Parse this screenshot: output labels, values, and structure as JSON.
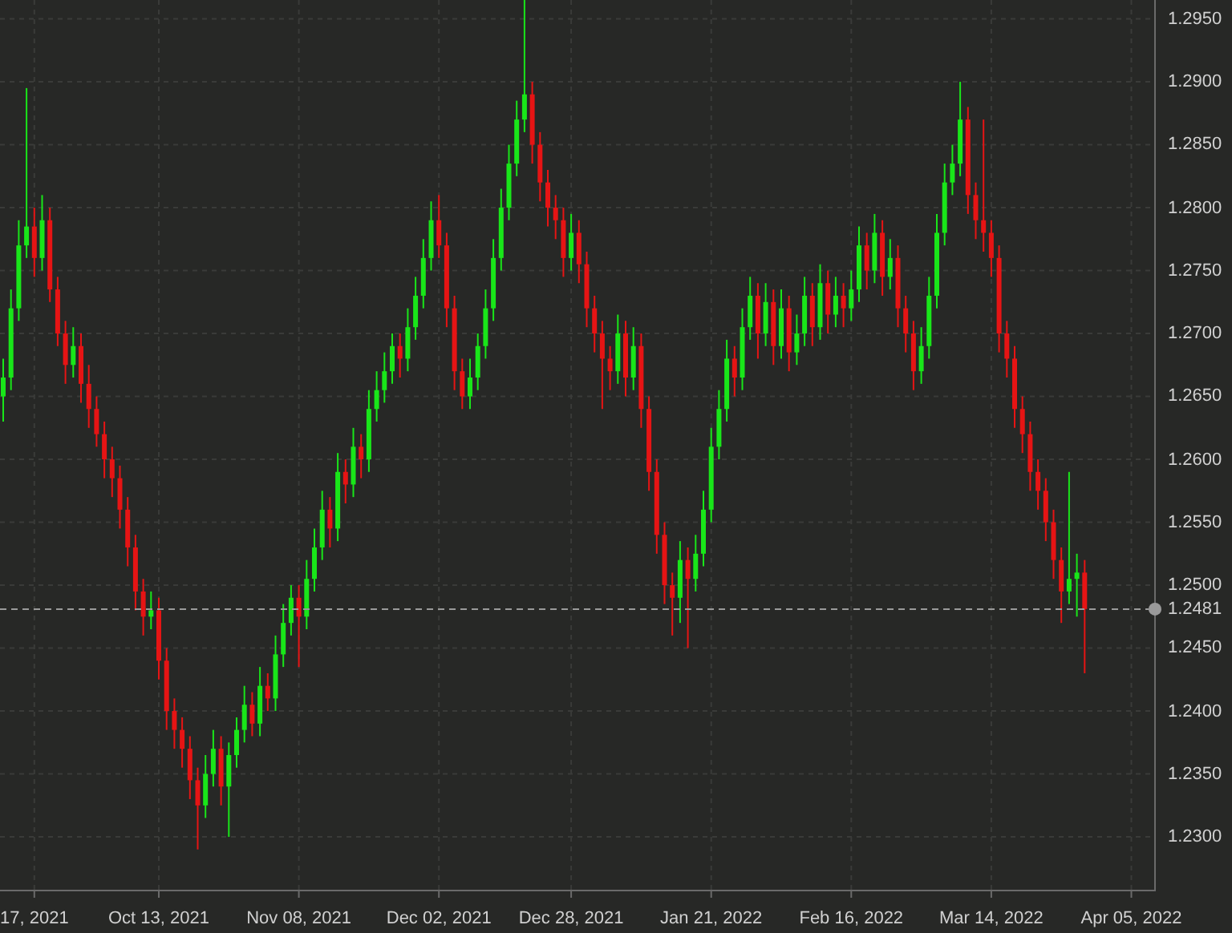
{
  "chart": {
    "chart_data": {
      "type": "candlestick",
      "categories": [
        null,
        null,
        null,
        null,
        "17, 2021",
        null,
        null,
        null,
        null,
        null,
        null,
        null,
        null,
        null,
        null,
        null,
        null,
        null,
        null,
        null,
        "Oct 13, 2021",
        null,
        null,
        null,
        null,
        null,
        null,
        null,
        null,
        null,
        null,
        null,
        null,
        null,
        null,
        null,
        null,
        null,
        "Nov 08, 2021",
        null,
        null,
        null,
        null,
        null,
        null,
        null,
        null,
        null,
        null,
        null,
        null,
        null,
        null,
        null,
        null,
        null,
        "Dec 02, 2021",
        null,
        null,
        null,
        null,
        null,
        null,
        null,
        null,
        null,
        null,
        null,
        null,
        null,
        null,
        null,
        null,
        "Dec 28, 2021",
        null,
        null,
        null,
        null,
        null,
        null,
        null,
        null,
        null,
        null,
        null,
        null,
        null,
        null,
        null,
        null,
        null,
        "Jan 21, 2022",
        null,
        null,
        null,
        null,
        null,
        null,
        null,
        null,
        null,
        null,
        null,
        null,
        null,
        null,
        null,
        null,
        null,
        "Feb 16, 2022",
        null,
        null,
        null,
        null,
        null,
        null,
        null,
        null,
        null,
        null,
        null,
        null,
        null,
        null,
        null,
        null,
        null,
        "Mar 14, 2022",
        null,
        null,
        null,
        null,
        null,
        null,
        null,
        null,
        null,
        null,
        null,
        null,
        null,
        null,
        null,
        null,
        null,
        "Apr 05, 2022"
      ],
      "ohlc": [
        [
          1.265,
          1.268,
          1.263,
          1.2665
        ],
        [
          1.2665,
          1.2735,
          1.2655,
          1.272
        ],
        [
          1.272,
          1.279,
          1.271,
          1.277
        ],
        [
          1.277,
          1.2895,
          1.276,
          1.2785
        ],
        [
          1.2785,
          1.28,
          1.2745,
          1.276
        ],
        [
          1.276,
          1.281,
          1.275,
          1.279
        ],
        [
          1.279,
          1.28,
          1.2725,
          1.2735
        ],
        [
          1.2735,
          1.2745,
          1.269,
          1.27
        ],
        [
          1.27,
          1.271,
          1.266,
          1.2675
        ],
        [
          1.2675,
          1.2705,
          1.2665,
          1.269
        ],
        [
          1.269,
          1.27,
          1.2645,
          1.266
        ],
        [
          1.266,
          1.2675,
          1.2625,
          1.264
        ],
        [
          1.264,
          1.265,
          1.261,
          1.262
        ],
        [
          1.262,
          1.263,
          1.2585,
          1.26
        ],
        [
          1.26,
          1.261,
          1.257,
          1.2585
        ],
        [
          1.2585,
          1.2595,
          1.2545,
          1.256
        ],
        [
          1.256,
          1.257,
          1.2515,
          1.253
        ],
        [
          1.253,
          1.254,
          1.248,
          1.2495
        ],
        [
          1.2495,
          1.2505,
          1.246,
          1.2475
        ],
        [
          1.2475,
          1.2495,
          1.2465,
          1.248
        ],
        [
          1.248,
          1.249,
          1.2425,
          1.244
        ],
        [
          1.244,
          1.245,
          1.2385,
          1.24
        ],
        [
          1.24,
          1.241,
          1.237,
          1.2385
        ],
        [
          1.2385,
          1.2395,
          1.2355,
          1.237
        ],
        [
          1.237,
          1.238,
          1.233,
          1.2345
        ],
        [
          1.2345,
          1.2355,
          1.229,
          1.2325
        ],
        [
          1.2325,
          1.2365,
          1.2315,
          1.235
        ],
        [
          1.235,
          1.2385,
          1.234,
          1.237
        ],
        [
          1.237,
          1.238,
          1.2325,
          1.234
        ],
        [
          1.234,
          1.2375,
          1.23,
          1.2365
        ],
        [
          1.2365,
          1.2395,
          1.2355,
          1.2385
        ],
        [
          1.2385,
          1.242,
          1.2375,
          1.2405
        ],
        [
          1.2405,
          1.2415,
          1.238,
          1.239
        ],
        [
          1.239,
          1.2435,
          1.238,
          1.242
        ],
        [
          1.242,
          1.243,
          1.24,
          1.241
        ],
        [
          1.241,
          1.246,
          1.24,
          1.2445
        ],
        [
          1.2445,
          1.2485,
          1.2435,
          1.247
        ],
        [
          1.247,
          1.25,
          1.246,
          1.249
        ],
        [
          1.249,
          1.25,
          1.2435,
          1.2475
        ],
        [
          1.2475,
          1.252,
          1.2465,
          1.2505
        ],
        [
          1.2505,
          1.2545,
          1.2495,
          1.253
        ],
        [
          1.253,
          1.2575,
          1.252,
          1.256
        ],
        [
          1.256,
          1.257,
          1.253,
          1.2545
        ],
        [
          1.2545,
          1.2605,
          1.2535,
          1.259
        ],
        [
          1.259,
          1.26,
          1.2565,
          1.258
        ],
        [
          1.258,
          1.2625,
          1.257,
          1.261
        ],
        [
          1.261,
          1.262,
          1.2585,
          1.26
        ],
        [
          1.26,
          1.2655,
          1.259,
          1.264
        ],
        [
          1.264,
          1.267,
          1.263,
          1.2655
        ],
        [
          1.2655,
          1.2685,
          1.2645,
          1.267
        ],
        [
          1.267,
          1.27,
          1.266,
          1.269
        ],
        [
          1.269,
          1.27,
          1.2665,
          1.268
        ],
        [
          1.268,
          1.272,
          1.267,
          1.2705
        ],
        [
          1.2705,
          1.2745,
          1.2695,
          1.273
        ],
        [
          1.273,
          1.2775,
          1.272,
          1.276
        ],
        [
          1.276,
          1.2805,
          1.275,
          1.279
        ],
        [
          1.279,
          1.281,
          1.276,
          1.277
        ],
        [
          1.277,
          1.278,
          1.2705,
          1.272
        ],
        [
          1.272,
          1.273,
          1.2655,
          1.267
        ],
        [
          1.267,
          1.268,
          1.264,
          1.265
        ],
        [
          1.265,
          1.268,
          1.264,
          1.2665
        ],
        [
          1.2665,
          1.27,
          1.2655,
          1.269
        ],
        [
          1.269,
          1.2735,
          1.268,
          1.272
        ],
        [
          1.272,
          1.2775,
          1.271,
          1.276
        ],
        [
          1.276,
          1.2815,
          1.275,
          1.28
        ],
        [
          1.28,
          1.285,
          1.279,
          1.2835
        ],
        [
          1.2835,
          1.2885,
          1.2825,
          1.287
        ],
        [
          1.287,
          1.2965,
          1.286,
          1.289
        ],
        [
          1.289,
          1.29,
          1.2835,
          1.285
        ],
        [
          1.285,
          1.286,
          1.2805,
          1.282
        ],
        [
          1.282,
          1.283,
          1.2785,
          1.28
        ],
        [
          1.28,
          1.281,
          1.2775,
          1.279
        ],
        [
          1.279,
          1.28,
          1.2745,
          1.276
        ],
        [
          1.276,
          1.2795,
          1.275,
          1.278
        ],
        [
          1.278,
          1.279,
          1.274,
          1.2755
        ],
        [
          1.2755,
          1.2765,
          1.2705,
          1.272
        ],
        [
          1.272,
          1.273,
          1.2685,
          1.27
        ],
        [
          1.27,
          1.271,
          1.264,
          1.268
        ],
        [
          1.268,
          1.269,
          1.2655,
          1.267
        ],
        [
          1.267,
          1.2715,
          1.266,
          1.27
        ],
        [
          1.27,
          1.271,
          1.265,
          1.2665
        ],
        [
          1.2665,
          1.2705,
          1.2655,
          1.269
        ],
        [
          1.269,
          1.27,
          1.2625,
          1.264
        ],
        [
          1.264,
          1.265,
          1.2575,
          1.259
        ],
        [
          1.259,
          1.26,
          1.2525,
          1.254
        ],
        [
          1.254,
          1.255,
          1.2485,
          1.25
        ],
        [
          1.25,
          1.251,
          1.246,
          1.249
        ],
        [
          1.249,
          1.2535,
          1.247,
          1.252
        ],
        [
          1.252,
          1.253,
          1.245,
          1.2505
        ],
        [
          1.2505,
          1.254,
          1.2495,
          1.2525
        ],
        [
          1.2525,
          1.2575,
          1.2515,
          1.256
        ],
        [
          1.256,
          1.2625,
          1.255,
          1.261
        ],
        [
          1.261,
          1.2655,
          1.26,
          1.264
        ],
        [
          1.264,
          1.2695,
          1.263,
          1.268
        ],
        [
          1.268,
          1.269,
          1.265,
          1.2665
        ],
        [
          1.2665,
          1.272,
          1.2655,
          1.2705
        ],
        [
          1.2705,
          1.2745,
          1.2695,
          1.273
        ],
        [
          1.273,
          1.274,
          1.268,
          1.27
        ],
        [
          1.27,
          1.274,
          1.269,
          1.2725
        ],
        [
          1.2725,
          1.2735,
          1.2675,
          1.269
        ],
        [
          1.269,
          1.2735,
          1.268,
          1.272
        ],
        [
          1.272,
          1.273,
          1.267,
          1.2685
        ],
        [
          1.2685,
          1.2715,
          1.2675,
          1.27
        ],
        [
          1.27,
          1.2745,
          1.269,
          1.273
        ],
        [
          1.273,
          1.274,
          1.269,
          1.2705
        ],
        [
          1.2705,
          1.2755,
          1.2695,
          1.274
        ],
        [
          1.274,
          1.275,
          1.27,
          1.2715
        ],
        [
          1.2715,
          1.2745,
          1.2705,
          1.273
        ],
        [
          1.273,
          1.274,
          1.2705,
          1.272
        ],
        [
          1.272,
          1.275,
          1.271,
          1.2735
        ],
        [
          1.2735,
          1.2785,
          1.2725,
          1.277
        ],
        [
          1.277,
          1.278,
          1.2735,
          1.275
        ],
        [
          1.275,
          1.2795,
          1.274,
          1.278
        ],
        [
          1.278,
          1.279,
          1.273,
          1.2745
        ],
        [
          1.2745,
          1.2775,
          1.2735,
          1.276
        ],
        [
          1.276,
          1.277,
          1.2705,
          1.272
        ],
        [
          1.272,
          1.273,
          1.2685,
          1.27
        ],
        [
          1.27,
          1.271,
          1.2655,
          1.267
        ],
        [
          1.267,
          1.2705,
          1.266,
          1.269
        ],
        [
          1.269,
          1.2745,
          1.268,
          1.273
        ],
        [
          1.273,
          1.2795,
          1.272,
          1.278
        ],
        [
          1.278,
          1.2835,
          1.277,
          1.282
        ],
        [
          1.282,
          1.285,
          1.281,
          1.2835
        ],
        [
          1.2835,
          1.29,
          1.2825,
          1.287
        ],
        [
          1.287,
          1.288,
          1.2795,
          1.281
        ],
        [
          1.281,
          1.282,
          1.2775,
          1.279
        ],
        [
          1.279,
          1.287,
          1.2765,
          1.278
        ],
        [
          1.278,
          1.279,
          1.2745,
          1.276
        ],
        [
          1.276,
          1.277,
          1.2685,
          1.27
        ],
        [
          1.27,
          1.271,
          1.2665,
          1.268
        ],
        [
          1.268,
          1.269,
          1.2625,
          1.264
        ],
        [
          1.264,
          1.265,
          1.2605,
          1.262
        ],
        [
          1.262,
          1.263,
          1.2575,
          1.259
        ],
        [
          1.259,
          1.26,
          1.256,
          1.2575
        ],
        [
          1.2575,
          1.2585,
          1.2535,
          1.255
        ],
        [
          1.255,
          1.256,
          1.2505,
          1.252
        ],
        [
          1.252,
          1.253,
          1.247,
          1.2495
        ],
        [
          1.2495,
          1.259,
          1.2485,
          1.2505
        ],
        [
          1.2505,
          1.2525,
          1.2475,
          1.251
        ],
        [
          1.251,
          1.252,
          1.243,
          1.2481
        ],
        null,
        null,
        null,
        null,
        null,
        null
      ],
      "ylim": [
        1.2258,
        1.2965
      ],
      "grid": true,
      "ref_lines": [
        {
          "axis": "y",
          "value": 1.2481,
          "label": "1.2481"
        }
      ],
      "yticks": [
        {
          "value": 1.295,
          "label": "1.2950"
        },
        {
          "value": 1.29,
          "label": "1.2900"
        },
        {
          "value": 1.285,
          "label": "1.2850"
        },
        {
          "value": 1.28,
          "label": "1.2800"
        },
        {
          "value": 1.275,
          "label": "1.2750"
        },
        {
          "value": 1.27,
          "label": "1.2700"
        },
        {
          "value": 1.265,
          "label": "1.2650"
        },
        {
          "value": 1.26,
          "label": "1.2600"
        },
        {
          "value": 1.255,
          "label": "1.2550"
        },
        {
          "value": 1.25,
          "label": "1.2500"
        },
        {
          "value": 1.245,
          "label": "1.2450"
        },
        {
          "value": 1.24,
          "label": "1.2400"
        },
        {
          "value": 1.235,
          "label": "1.2350"
        },
        {
          "value": 1.23,
          "label": "1.2300"
        }
      ]
    }
  }
}
